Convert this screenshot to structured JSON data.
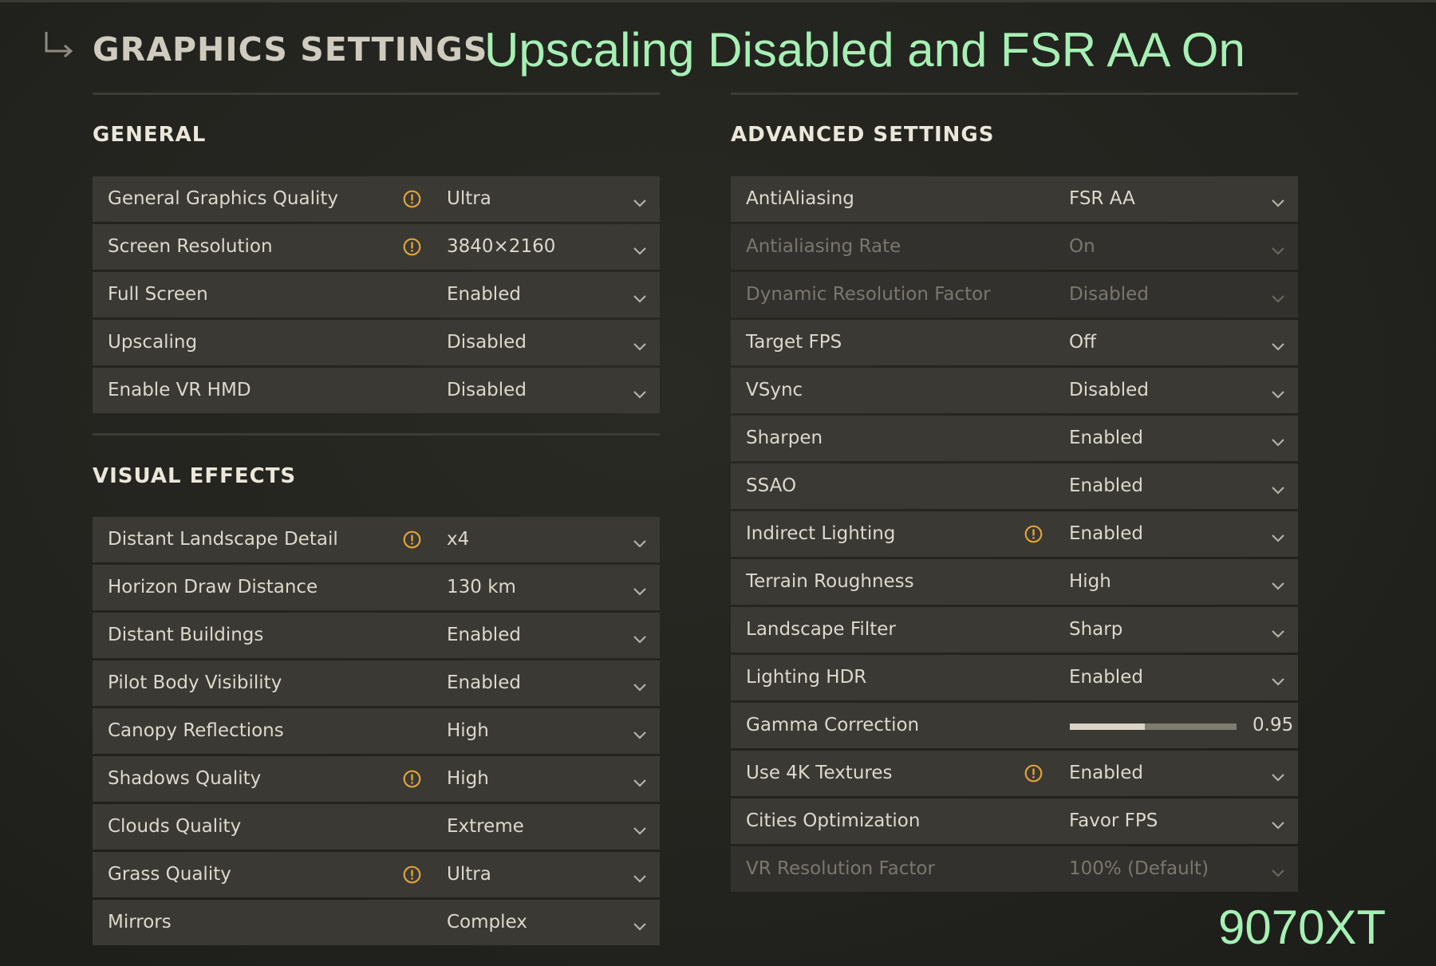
{
  "header": {
    "title": "GRAPHICS SETTINGS",
    "overlay_caption": "Upscaling Disabled and FSR AA On",
    "gpu_label": "9070XT"
  },
  "colors": {
    "accent_overlay": "#a6f0b4",
    "warning": "#e0a23a",
    "row_bg": "#3a3934"
  },
  "general": {
    "title": "GENERAL",
    "rows": [
      {
        "label": "General Graphics Quality",
        "value": "Ultra",
        "warning": true
      },
      {
        "label": "Screen Resolution",
        "value": "3840×2160",
        "warning": true
      },
      {
        "label": "Full Screen",
        "value": "Enabled",
        "warning": false
      },
      {
        "label": "Upscaling",
        "value": "Disabled",
        "warning": false
      },
      {
        "label": "Enable VR HMD",
        "value": "Disabled",
        "warning": false
      }
    ]
  },
  "visual_effects": {
    "title": "VISUAL EFFECTS",
    "rows": [
      {
        "label": "Distant Landscape Detail",
        "value": "x4",
        "warning": true
      },
      {
        "label": "Horizon Draw Distance",
        "value": "130 km",
        "warning": false
      },
      {
        "label": "Distant Buildings",
        "value": "Enabled",
        "warning": false
      },
      {
        "label": "Pilot Body Visibility",
        "value": "Enabled",
        "warning": false
      },
      {
        "label": "Canopy Reflections",
        "value": "High",
        "warning": false
      },
      {
        "label": "Shadows Quality",
        "value": "High",
        "warning": true
      },
      {
        "label": "Clouds Quality",
        "value": "Extreme",
        "warning": false
      },
      {
        "label": "Grass Quality",
        "value": "Ultra",
        "warning": true
      },
      {
        "label": "Mirrors",
        "value": "Complex",
        "warning": false
      }
    ]
  },
  "advanced": {
    "title": "ADVANCED SETTINGS",
    "rows": [
      {
        "label": "AntiAliasing",
        "value": "FSR AA",
        "warning": false,
        "disabled": false
      },
      {
        "label": "Antialiasing Rate",
        "value": "On",
        "warning": false,
        "disabled": true
      },
      {
        "label": "Dynamic Resolution Factor",
        "value": "Disabled",
        "warning": false,
        "disabled": true
      },
      {
        "label": "Target FPS",
        "value": "Off",
        "warning": false,
        "disabled": false
      },
      {
        "label": "VSync",
        "value": "Disabled",
        "warning": false,
        "disabled": false
      },
      {
        "label": "Sharpen",
        "value": "Enabled",
        "warning": false,
        "disabled": false
      },
      {
        "label": "SSAO",
        "value": "Enabled",
        "warning": false,
        "disabled": false
      },
      {
        "label": "Indirect Lighting",
        "value": "Enabled",
        "warning": true,
        "disabled": false
      },
      {
        "label": "Terrain Roughness",
        "value": "High",
        "warning": false,
        "disabled": false
      },
      {
        "label": "Landscape Filter",
        "value": "Sharp",
        "warning": false,
        "disabled": false
      },
      {
        "label": "Lighting HDR",
        "value": "Enabled",
        "warning": false,
        "disabled": false
      },
      {
        "label": "Gamma Correction",
        "value": "0.95",
        "warning": false,
        "disabled": false,
        "slider": true,
        "slider_fraction": 0.45
      },
      {
        "label": "Use 4K Textures",
        "value": "Enabled",
        "warning": true,
        "disabled": false
      },
      {
        "label": "Cities Optimization",
        "value": "Favor FPS",
        "warning": false,
        "disabled": false
      },
      {
        "label": "VR Resolution Factor",
        "value": "100% (Default)",
        "warning": false,
        "disabled": true
      }
    ]
  }
}
